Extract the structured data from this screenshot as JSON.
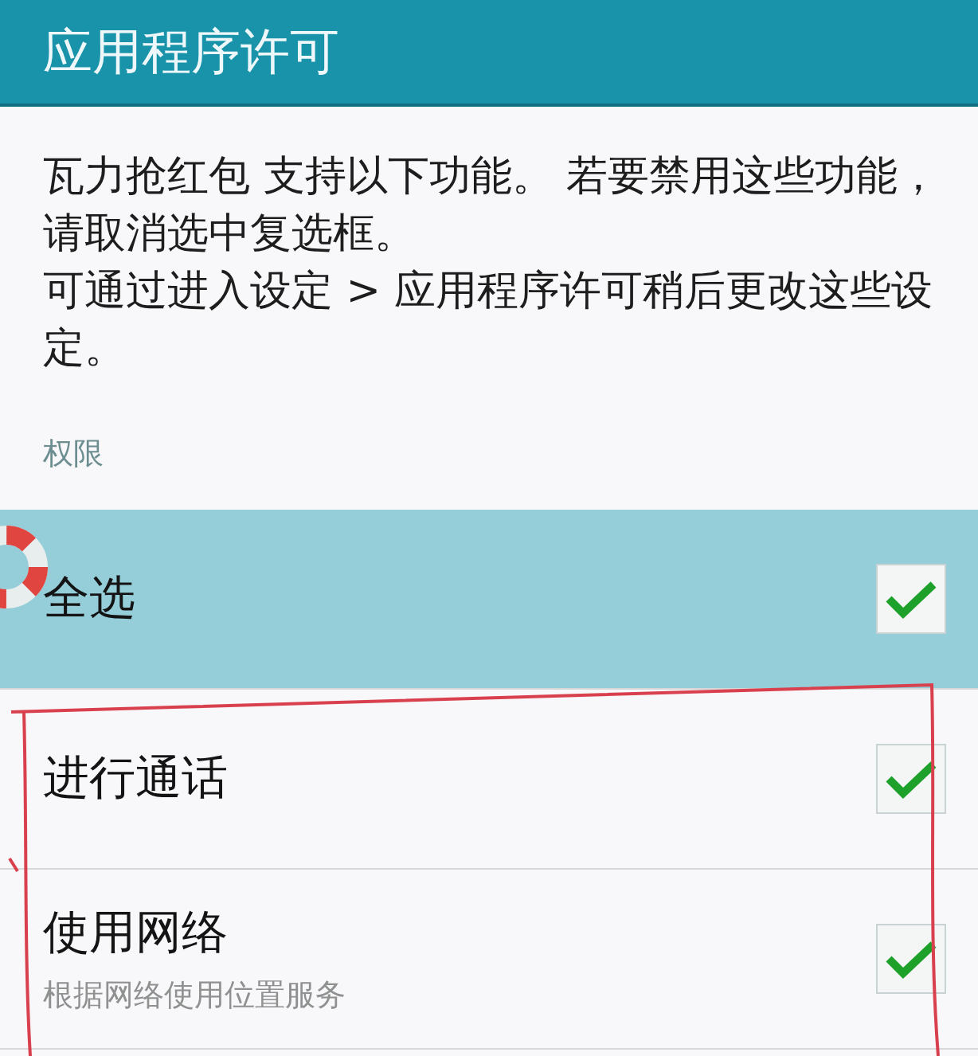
{
  "header": {
    "title": "应用程序许可"
  },
  "description": [
    "瓦力抢红包 支持以下功能。 若要禁用这些功能，请取消选中复选框。",
    "可通过进入设定 > 应用程序许可稍后更改这些设定。"
  ],
  "section_label": "权限",
  "select_all": {
    "label": "全选",
    "checked": true
  },
  "permissions": [
    {
      "label": "进行通话",
      "checked": true
    },
    {
      "label": "使用网络",
      "subtitle": "根据网络使用位置服务",
      "checked": true
    }
  ]
}
